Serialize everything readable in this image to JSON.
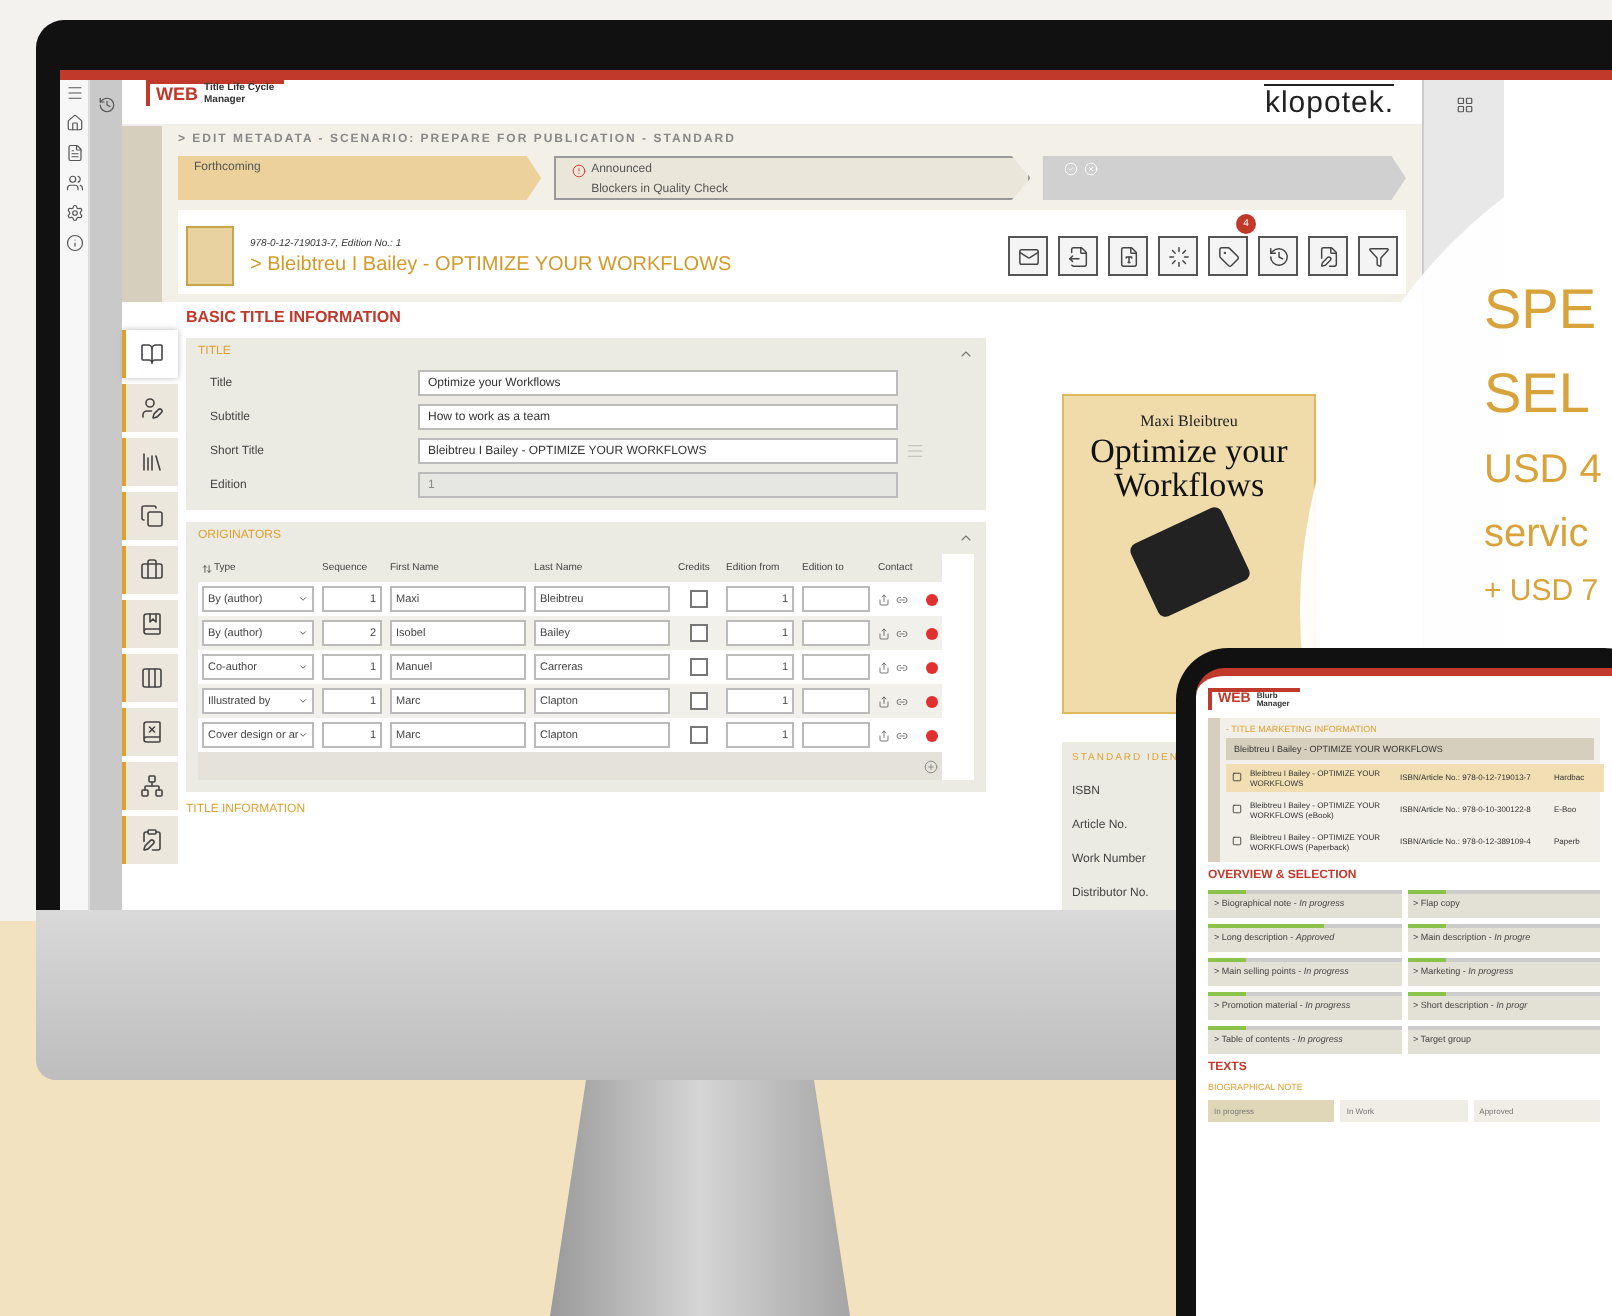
{
  "app": {
    "logo": {
      "mark": "WEB",
      "product": "Title Life Cycle Manager"
    },
    "brand": "klopotek.",
    "breadcrumb": "> EDIT METADATA - SCENARIO: PREPARE FOR PUBLICATION - STANDARD",
    "workflow": [
      {
        "label": "Forthcoming",
        "kind": "done",
        "alert": false
      },
      {
        "label": "Announced",
        "note": "Blockers in Quality Check",
        "kind": "current",
        "alert": true
      },
      {
        "kind": "pending",
        "alert": false
      }
    ],
    "edition_line": "978-0-12-719013-7, Edition No.: 1",
    "heading": "> Bleibtreu I Bailey - OPTIMIZE YOUR WORKFLOWS",
    "badge": "4",
    "section": "BASIC TITLE INFORMATION",
    "side_tabs": [
      {
        "selected": true
      },
      {
        "selected": false
      },
      {
        "selected": false
      },
      {
        "selected": false
      },
      {
        "selected": false
      },
      {
        "selected": false
      },
      {
        "selected": false
      },
      {
        "selected": false
      },
      {
        "selected": false
      },
      {
        "selected": false
      }
    ],
    "title_group": {
      "heading": "TITLE",
      "expanded": true,
      "fields": [
        {
          "label": "Title",
          "value": "Optimize your Workflows",
          "disabled": false
        },
        {
          "label": "Subtitle",
          "value": "How to work as a team",
          "disabled": false
        },
        {
          "label": "Short Title",
          "value": "Bleibtreu I Bailey - OPTIMIZE YOUR WORKFLOWS",
          "disabled": false
        },
        {
          "label": "Edition",
          "value": "1",
          "disabled": true
        }
      ]
    },
    "originators": {
      "heading": "ORIGINATORS",
      "expanded": true,
      "columns": [
        "Type",
        "Sequence",
        "First Name",
        "Last Name",
        "Credits",
        "Edition from",
        "Edition to",
        "Contact"
      ],
      "rows": [
        {
          "type": "By (author)",
          "sequence": "1",
          "first": "Maxi",
          "last": "Bleibtreu",
          "credits": false,
          "from": "1"
        },
        {
          "type": "By (author)",
          "sequence": "2",
          "first": "Isobel",
          "last": "Bailey",
          "credits": false,
          "from": "1"
        },
        {
          "type": "Co-author",
          "sequence": "1",
          "first": "Manuel",
          "last": "Carreras",
          "credits": false,
          "from": "1"
        },
        {
          "type": "Illustrated by",
          "sequence": "1",
          "first": "Marc",
          "last": "Clapton",
          "credits": false,
          "from": "1"
        },
        {
          "type": "Cover design or ar",
          "sequence": "1",
          "first": "Marc",
          "last": "Clapton",
          "credits": false,
          "from": "1"
        }
      ]
    },
    "next_section": "TITLE INFORMATION",
    "cover": {
      "author": "Maxi Bleibtreu",
      "title": "Optimize your Workflows"
    },
    "identifiers": {
      "heading": "STANDARD IDEN",
      "labels": [
        "ISBN",
        "Article No.",
        "Work Number",
        "Distributor No."
      ]
    }
  },
  "promo": {
    "lines": [
      {
        "text": "SPE",
        "kind": "big"
      },
      {
        "text": "SEL",
        "kind": "big"
      },
      {
        "text": "USD 4",
        "kind": "mid"
      },
      {
        "text": "servic",
        "kind": "mid"
      },
      {
        "text": "+ USD 7",
        "kind": "small"
      }
    ]
  },
  "tablet": {
    "logo": {
      "mark": "WEB",
      "product": "Blurb Manager"
    },
    "breadcrumb": "- TITLE MARKETING INFORMATION",
    "tree": {
      "label": "Bleibtreu I Bailey - OPTIMIZE YOUR WORKFLOWS",
      "children": [
        {
          "label": "Bleibtreu I Bailey - OPTIMIZE YOUR WORKFLOWS",
          "isbn": "ISBN/Article No.: 978-0-12-719013-7",
          "format": "Hardbac",
          "selected": true
        },
        {
          "label": "Bleibtreu I Bailey - OPTIMIZE YOUR WORKFLOWS (eBook)",
          "isbn": "ISBN/Article No.: 978-0-10-300122-8",
          "format": "E-Boo",
          "selected": false
        },
        {
          "label": "Bleibtreu I Bailey - OPTIMIZE YOUR WORKFLOWS (Paperback)",
          "isbn": "ISBN/Article No.: 978-0-12-389109-4",
          "format": "Paperb",
          "selected": false
        }
      ]
    },
    "overview": {
      "heading": "OVERVIEW & SELECTION",
      "items": [
        {
          "label": "> Biographical note - *In progress*",
          "level": 0.2
        },
        {
          "label": "> Flap copy",
          "level": 0.2
        },
        {
          "label": "> Long description - *Approved*",
          "level": 0.6
        },
        {
          "label": "> Main description - *In progre*",
          "level": 0.2
        },
        {
          "label": "> Main selling points - *In progress*",
          "level": 0.2
        },
        {
          "label": "> Marketing - *In progress*",
          "level": 0.2
        },
        {
          "label": "> Promotion material - *In progress*",
          "level": 0.2
        },
        {
          "label": "> Short description - *In progr*",
          "level": 0.2
        },
        {
          "label": "> Table of contents - *In progress*",
          "level": 0.2
        },
        {
          "label": "> Target group"
        }
      ]
    },
    "texts": {
      "heading": "TEXTS",
      "note": "BIOGRAPHICAL NOTE",
      "steps": [
        {
          "label": "In progress",
          "selected": true
        },
        {
          "label": "In Work",
          "selected": false
        },
        {
          "label": "Approved",
          "selected": false
        }
      ]
    }
  }
}
